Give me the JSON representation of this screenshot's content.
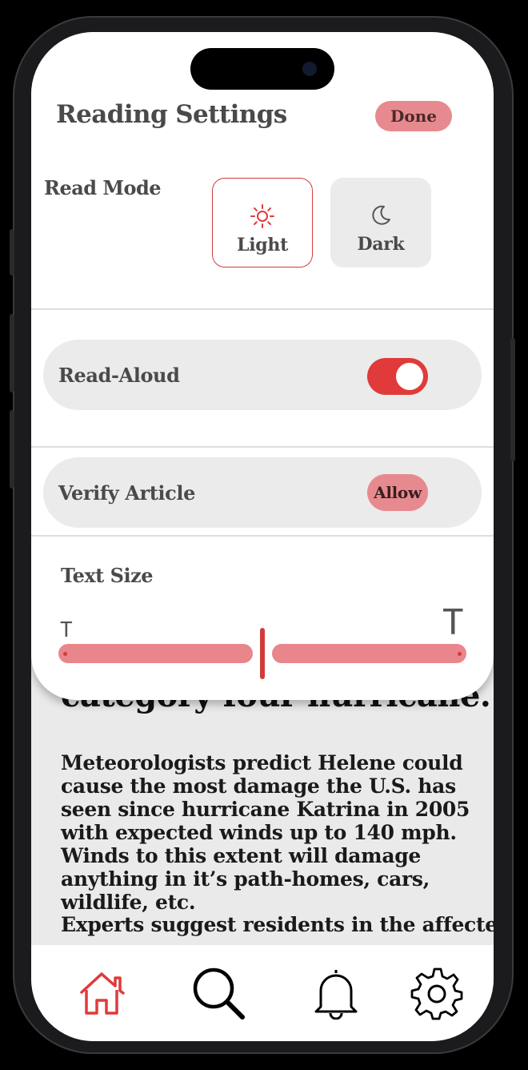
{
  "sheet": {
    "title": "Reading Settings",
    "done_label": "Done",
    "read_mode": {
      "label": "Read Mode",
      "options": [
        {
          "label": "Light",
          "icon": "sun-icon",
          "selected": true
        },
        {
          "label": "Dark",
          "icon": "moon-icon",
          "selected": false
        }
      ]
    },
    "read_aloud": {
      "label": "Read-Aloud",
      "enabled": true
    },
    "verify_article": {
      "label": "Verify Article",
      "button_label": "Allow"
    },
    "text_size": {
      "label": "Text Size",
      "small_glyph": "T",
      "large_glyph": "T",
      "level_fraction": 0.5
    }
  },
  "article": {
    "headline": "category four hurricane.",
    "paragraph_1": "Meteorologists predict Helene could cause the most damage the U.S. has seen since hurricane Katrina in 2005 with expected winds up to 140 mph. Winds to this extent will damage anything in it’s path-homes, cars, wildlife, etc.",
    "paragraph_2": "Experts suggest residents in the affected"
  },
  "tabbar": {
    "items": [
      {
        "icon": "home-icon",
        "active": true
      },
      {
        "icon": "search-icon",
        "active": false
      },
      {
        "icon": "bell-icon",
        "active": false
      },
      {
        "icon": "gear-icon",
        "active": false
      }
    ]
  },
  "colors": {
    "accent": "#e03a3a",
    "accent_soft": "#e78a8f",
    "pill_bg": "#ebebeb",
    "text": "#4a4a4a"
  }
}
